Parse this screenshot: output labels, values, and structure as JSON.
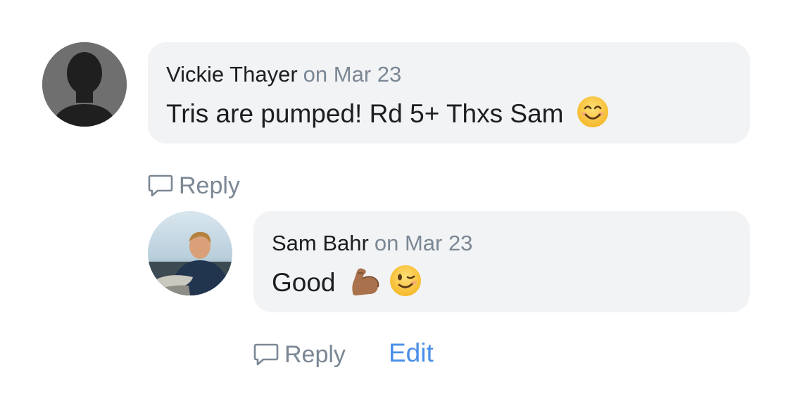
{
  "comments": [
    {
      "author": "Vickie Thayer",
      "date": "on Mar 23",
      "text": "Tris are pumped! Rd 5+ Thxs Sam",
      "emojis": [
        "smiling-face-icon"
      ],
      "avatar": "default-silhouette",
      "actions": {
        "reply": "Reply"
      }
    },
    {
      "author": "Sam Bahr",
      "date": "on Mar 23",
      "text": "Good",
      "emojis": [
        "flexed-biceps-icon",
        "winking-face-icon"
      ],
      "avatar": "user-photo",
      "actions": {
        "reply": "Reply",
        "edit": "Edit"
      }
    }
  ],
  "colors": {
    "bubble": "#f2f3f5",
    "muted": "#7b8794",
    "link": "#4a8fe7",
    "text": "#1c1e21"
  }
}
